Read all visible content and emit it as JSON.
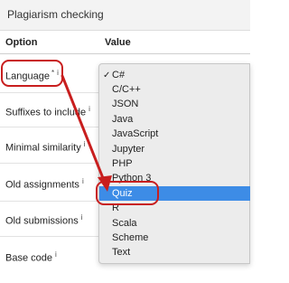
{
  "header": {
    "title": "Plagiarism checking"
  },
  "table": {
    "columns": {
      "option": "Option",
      "value": "Value"
    },
    "rows": [
      {
        "label": "Language",
        "required": "*",
        "info": "i"
      },
      {
        "label": "Suffixes to include",
        "info": "i"
      },
      {
        "label": "Minimal similarity",
        "info": "i"
      },
      {
        "label": "Old assignments",
        "info": "i"
      },
      {
        "label": "Old submissions",
        "info": "i"
      },
      {
        "label": "Base code",
        "info": "i"
      }
    ]
  },
  "dropdown": {
    "selected_check": "✓",
    "options": [
      "C#",
      "C/C++",
      "JSON",
      "Java",
      "JavaScript",
      "Jupyter",
      "PHP",
      "Python 3",
      "Quiz",
      "R",
      "Scala",
      "Scheme",
      "Text"
    ],
    "selected_value": "C#",
    "highlighted_value": "Quiz",
    "highlight_color": "#3d8ce6"
  },
  "annotation": {
    "color": "#c81e1e"
  }
}
